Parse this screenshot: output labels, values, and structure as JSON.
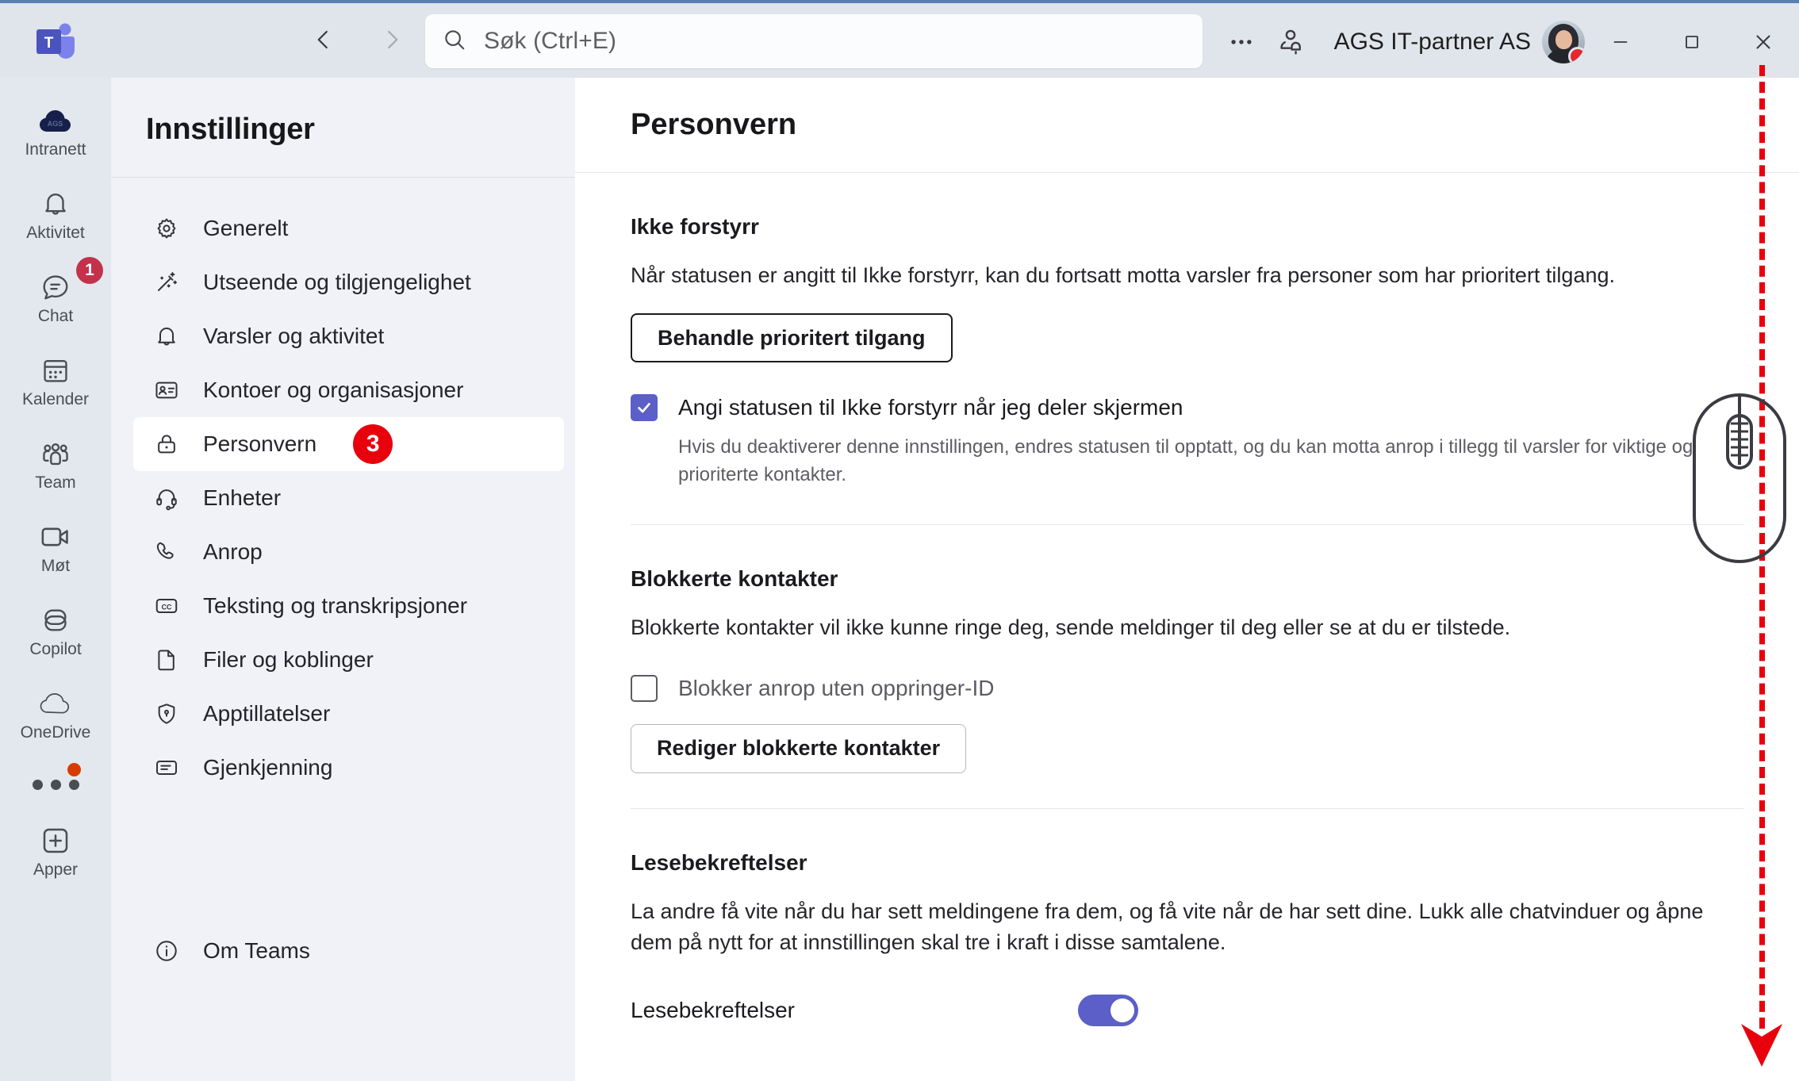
{
  "titlebar": {
    "back_tooltip": "Tilbake",
    "forward_tooltip": "Frem",
    "search_placeholder": "Søk (Ctrl+E)",
    "more_label": "…",
    "account_name": "AGS IT-partner AS",
    "minimize_label": "Minimer",
    "maximize_label": "Maksimer",
    "close_label": "Lukk"
  },
  "rail": {
    "items": [
      {
        "label": "Intranett",
        "icon": "cloud-ags-icon",
        "badge": null
      },
      {
        "label": "Aktivitet",
        "icon": "bell-icon",
        "badge": null
      },
      {
        "label": "Chat",
        "icon": "chat-icon",
        "badge": "1"
      },
      {
        "label": "Kalender",
        "icon": "calendar-icon",
        "badge": null
      },
      {
        "label": "Team",
        "icon": "people-icon",
        "badge": null
      },
      {
        "label": "Møt",
        "icon": "video-icon",
        "badge": null
      },
      {
        "label": "Copilot",
        "icon": "copilot-icon",
        "badge": null
      },
      {
        "label": "OneDrive",
        "icon": "cloud-icon",
        "badge": null
      }
    ],
    "more_label": "Mer",
    "apps_label": "Apper",
    "apps_icon": "plus-box-icon"
  },
  "settings": {
    "title": "Innstillinger",
    "items": [
      {
        "label": "Generelt",
        "icon": "gear-icon",
        "selected": false,
        "badge": null
      },
      {
        "label": "Utseende og tilgjengelighet",
        "icon": "wand-icon",
        "selected": false,
        "badge": null
      },
      {
        "label": "Varsler og aktivitet",
        "icon": "bell-icon",
        "selected": false,
        "badge": null
      },
      {
        "label": "Kontoer og organisasjoner",
        "icon": "id-card-icon",
        "selected": false,
        "badge": null
      },
      {
        "label": "Personvern",
        "icon": "lock-icon",
        "selected": true,
        "badge": "3"
      },
      {
        "label": "Enheter",
        "icon": "headset-icon",
        "selected": false,
        "badge": null
      },
      {
        "label": "Anrop",
        "icon": "phone-icon",
        "selected": false,
        "badge": null
      },
      {
        "label": "Teksting og transkripsjoner",
        "icon": "closed-caption-icon",
        "selected": false,
        "badge": null
      },
      {
        "label": "Filer og koblinger",
        "icon": "file-icon",
        "selected": false,
        "badge": null
      },
      {
        "label": "Apptillatelser",
        "icon": "shield-key-icon",
        "selected": false,
        "badge": null
      },
      {
        "label": "Gjenkjenning",
        "icon": "recognition-icon",
        "selected": false,
        "badge": null
      }
    ],
    "about_label": "Om Teams",
    "about_icon": "info-icon"
  },
  "main": {
    "heading": "Personvern",
    "dnd": {
      "title": "Ikke forstyrr",
      "description": "Når statusen er angitt til Ikke forstyrr, kan du fortsatt motta varsler fra personer som har prioritert tilgang.",
      "button_label": "Behandle prioritert tilgang",
      "checkbox_label": "Angi statusen til Ikke forstyrr når jeg deler skjermen",
      "checkbox_checked": true,
      "checkbox_description": "Hvis du deaktiverer denne innstillingen, endres statusen til opptatt, og du kan motta anrop i tillegg til varsler for viktige og prioriterte kontakter."
    },
    "blocked": {
      "title": "Blokkerte kontakter",
      "description": "Blokkerte kontakter vil ikke kunne ringe deg, sende meldinger til deg eller se at du er tilstede.",
      "checkbox_label": "Blokker anrop uten oppringer-ID",
      "checkbox_checked": false,
      "button_label": "Rediger blokkerte kontakter"
    },
    "receipts": {
      "title": "Lesebekreftelser",
      "description": "La andre få vite når du har sett meldingene fra dem, og få vite når de har sett dine. Lukk alle chatvinduer og åpne dem på nytt for at innstillingen skal tre i kraft i disse samtalene.",
      "toggle_label": "Lesebekreftelser",
      "toggle_on": true
    }
  },
  "colors": {
    "accent": "#5b5fc7",
    "badge_red": "#e8000d",
    "rail_badge_red": "#c4314b",
    "annotation_red": "#e8000d",
    "titlebar_bg": "#e0e5eb",
    "sidebar_bg": "#f0f2f7"
  }
}
